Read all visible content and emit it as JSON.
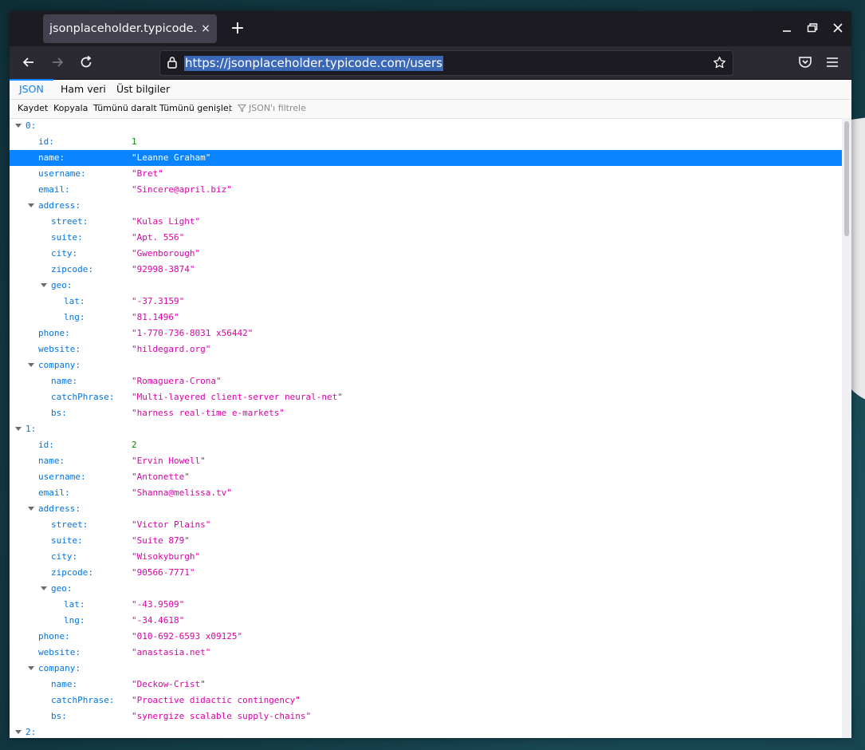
{
  "browser": {
    "tab_title": "jsonplaceholder.typicode.com",
    "tab_close": "×",
    "new_tab": "+",
    "url": "https://jsonplaceholder.typicode.com/users"
  },
  "viewer": {
    "tabs": [
      "JSON",
      "Ham veri",
      "Üst bilgiler"
    ],
    "active_tab": "JSON",
    "toolbar": {
      "save": "Kaydet",
      "copy": "Kopyala",
      "collapse_all": "Tümünü daralt",
      "expand_all": "Tümünü genişlet",
      "filter_placeholder": "JSON'ı filtrele"
    }
  },
  "json_rows": [
    {
      "key": "0:",
      "value": "",
      "type": "obj",
      "level": 0,
      "expanded": true
    },
    {
      "key": "id:",
      "value": "1",
      "type": "num",
      "level": 1
    },
    {
      "key": "name:",
      "value": "\"Leanne Graham\"",
      "type": "str",
      "level": 1,
      "selected": true
    },
    {
      "key": "username:",
      "value": "\"Bret\"",
      "type": "str",
      "level": 1
    },
    {
      "key": "email:",
      "value": "\"Sincere@april.biz\"",
      "type": "str",
      "level": 1
    },
    {
      "key": "address:",
      "value": "",
      "type": "obj",
      "level": 1,
      "expanded": true
    },
    {
      "key": "street:",
      "value": "\"Kulas Light\"",
      "type": "str",
      "level": 2
    },
    {
      "key": "suite:",
      "value": "\"Apt. 556\"",
      "type": "str",
      "level": 2
    },
    {
      "key": "city:",
      "value": "\"Gwenborough\"",
      "type": "str",
      "level": 2
    },
    {
      "key": "zipcode:",
      "value": "\"92998-3874\"",
      "type": "str",
      "level": 2
    },
    {
      "key": "geo:",
      "value": "",
      "type": "obj",
      "level": 2,
      "expanded": true
    },
    {
      "key": "lat:",
      "value": "\"-37.3159\"",
      "type": "str",
      "level": 3
    },
    {
      "key": "lng:",
      "value": "\"81.1496\"",
      "type": "str",
      "level": 3
    },
    {
      "key": "phone:",
      "value": "\"1-770-736-8031 x56442\"",
      "type": "str",
      "level": 1
    },
    {
      "key": "website:",
      "value": "\"hildegard.org\"",
      "type": "str",
      "level": 1
    },
    {
      "key": "company:",
      "value": "",
      "type": "obj",
      "level": 1,
      "expanded": true
    },
    {
      "key": "name:",
      "value": "\"Romaguera-Crona\"",
      "type": "str",
      "level": 2
    },
    {
      "key": "catchPhrase:",
      "value": "\"Multi-layered client-server neural-net\"",
      "type": "str",
      "level": 2
    },
    {
      "key": "bs:",
      "value": "\"harness real-time e-markets\"",
      "type": "str",
      "level": 2
    },
    {
      "key": "1:",
      "value": "",
      "type": "obj",
      "level": 0,
      "expanded": true
    },
    {
      "key": "id:",
      "value": "2",
      "type": "num",
      "level": 1
    },
    {
      "key": "name:",
      "value": "\"Ervin Howell\"",
      "type": "str",
      "level": 1
    },
    {
      "key": "username:",
      "value": "\"Antonette\"",
      "type": "str",
      "level": 1
    },
    {
      "key": "email:",
      "value": "\"Shanna@melissa.tv\"",
      "type": "str",
      "level": 1
    },
    {
      "key": "address:",
      "value": "",
      "type": "obj",
      "level": 1,
      "expanded": true
    },
    {
      "key": "street:",
      "value": "\"Victor Plains\"",
      "type": "str",
      "level": 2
    },
    {
      "key": "suite:",
      "value": "\"Suite 879\"",
      "type": "str",
      "level": 2
    },
    {
      "key": "city:",
      "value": "\"Wisokyburgh\"",
      "type": "str",
      "level": 2
    },
    {
      "key": "zipcode:",
      "value": "\"90566-7771\"",
      "type": "str",
      "level": 2
    },
    {
      "key": "geo:",
      "value": "",
      "type": "obj",
      "level": 2,
      "expanded": true
    },
    {
      "key": "lat:",
      "value": "\"-43.9509\"",
      "type": "str",
      "level": 3
    },
    {
      "key": "lng:",
      "value": "\"-34.4618\"",
      "type": "str",
      "level": 3
    },
    {
      "key": "phone:",
      "value": "\"010-692-6593 x09125\"",
      "type": "str",
      "level": 1
    },
    {
      "key": "website:",
      "value": "\"anastasia.net\"",
      "type": "str",
      "level": 1
    },
    {
      "key": "company:",
      "value": "",
      "type": "obj",
      "level": 1,
      "expanded": true
    },
    {
      "key": "name:",
      "value": "\"Deckow-Crist\"",
      "type": "str",
      "level": 2
    },
    {
      "key": "catchPhrase:",
      "value": "\"Proactive didactic contingency\"",
      "type": "str",
      "level": 2
    },
    {
      "key": "bs:",
      "value": "\"synergize scalable supply-chains\"",
      "type": "str",
      "level": 2
    },
    {
      "key": "2:",
      "value": "",
      "type": "obj",
      "level": 0,
      "expanded": true
    }
  ],
  "colors": {
    "key": "#0074e8",
    "string": "#dd00a9",
    "number": "#058b00",
    "selection": "#0a84ff"
  }
}
